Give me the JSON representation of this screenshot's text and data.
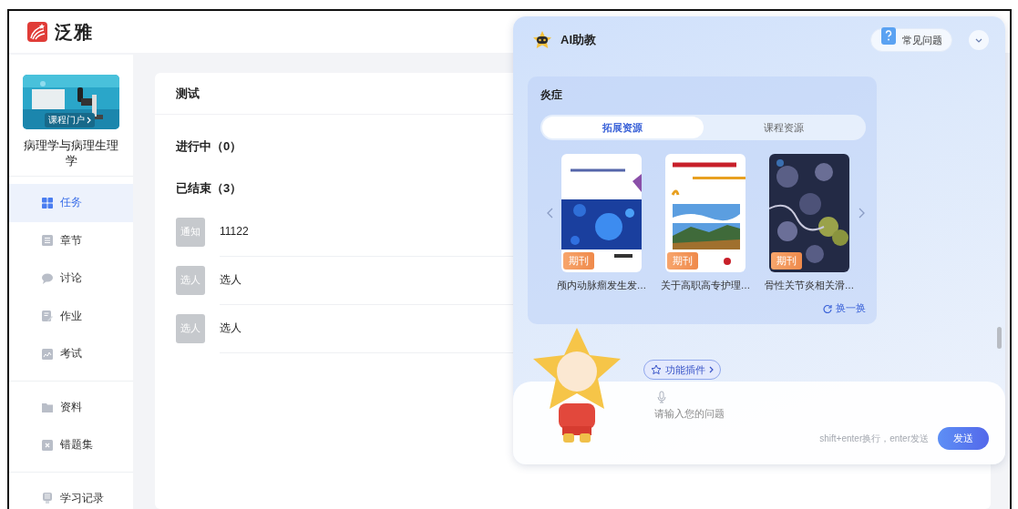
{
  "app": {
    "name": "泛雅"
  },
  "sidebar": {
    "course_portal": "课程门户",
    "course_title": "病理学与病理生理学",
    "sections": [
      {
        "items": [
          {
            "label": "任务",
            "selected": true
          },
          {
            "label": "章节",
            "selected": false
          },
          {
            "label": "讨论",
            "selected": false
          },
          {
            "label": "作业",
            "selected": false
          },
          {
            "label": "考试",
            "selected": false
          }
        ]
      },
      {
        "items": [
          {
            "label": "资料",
            "selected": false
          },
          {
            "label": "错题集",
            "selected": false
          }
        ]
      },
      {
        "items": [
          {
            "label": "学习记录",
            "selected": false
          }
        ]
      }
    ]
  },
  "tasks": {
    "title": "测试",
    "sections": [
      {
        "heading": "进行中（0）"
      },
      {
        "heading": "已结束（3）",
        "rows": [
          {
            "tag": "通知",
            "name": "11122"
          },
          {
            "tag": "选人",
            "name": "选人"
          },
          {
            "tag": "选人",
            "name": "选人"
          }
        ]
      }
    ]
  },
  "assistant": {
    "title": "AI助教",
    "faq": "常见问题",
    "topic": "炎症",
    "tabs": [
      {
        "label": "拓展资源",
        "selected": true
      },
      {
        "label": "课程资源",
        "selected": false
      }
    ],
    "books": [
      {
        "badge": "期刊",
        "title": "颅内动脉瘤发生发…"
      },
      {
        "badge": "期刊",
        "title": "关于高职高专护理…"
      },
      {
        "badge": "期刊",
        "title": "骨性关节炎相关滑…"
      }
    ],
    "refresh": "换一换",
    "plugin": "功能插件",
    "input": {
      "placeholder": "请输入您的问题"
    },
    "hint": "shift+enter换行，enter发送",
    "send": "发送"
  }
}
